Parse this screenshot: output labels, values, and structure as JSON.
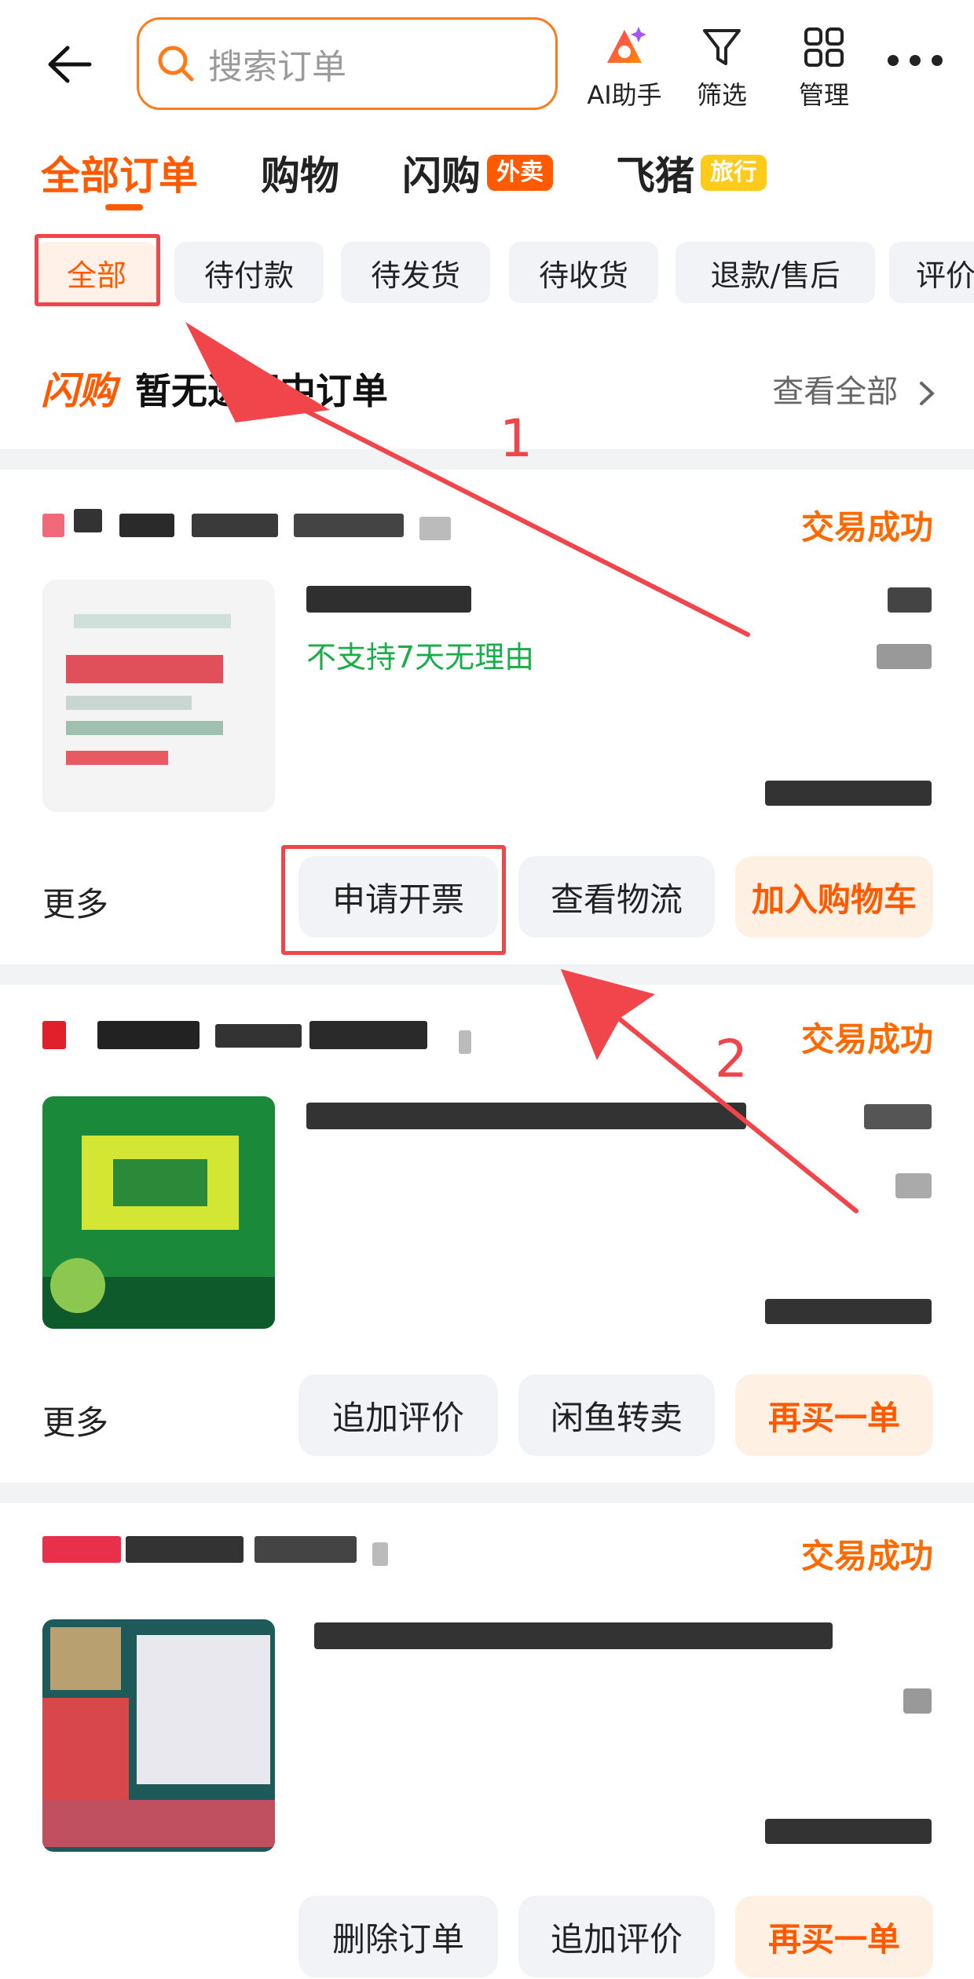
{
  "header": {
    "search_placeholder": "搜索订单",
    "tools": [
      {
        "label": "AI助手",
        "icon": "ai-assistant-icon"
      },
      {
        "label": "筛选",
        "icon": "filter-icon"
      },
      {
        "label": "管理",
        "icon": "grid-manage-icon"
      }
    ],
    "more_icon": "more-dots-icon"
  },
  "tabs": [
    {
      "label": "全部订单",
      "active": true
    },
    {
      "label": "购物"
    },
    {
      "label": "闪购",
      "badge": "外卖"
    },
    {
      "label": "飞猪",
      "badge": "旅行"
    }
  ],
  "filters": [
    "全部",
    "待付款",
    "待发货",
    "待收货",
    "退款/售后",
    "评价"
  ],
  "flash": {
    "logo": "闪购",
    "text": "暂无进行中订单",
    "view_all": "查看全部"
  },
  "orders": [
    {
      "status": "交易成功",
      "tag": "不支持7天无理由",
      "more": "更多",
      "buttons": [
        "申请开票",
        "查看物流",
        "加入购物车"
      ]
    },
    {
      "status": "交易成功",
      "more": "更多",
      "buttons": [
        "追加评价",
        "闲鱼转卖",
        "再买一单"
      ]
    },
    {
      "status": "交易成功",
      "buttons": [
        "删除订单",
        "追加评价",
        "再买一单"
      ]
    }
  ],
  "annotations": {
    "step1": "1",
    "step2": "2"
  },
  "colors": {
    "accent": "#ff5a00",
    "annotation_red": "#f0454a",
    "green_tag": "#1aad49"
  }
}
